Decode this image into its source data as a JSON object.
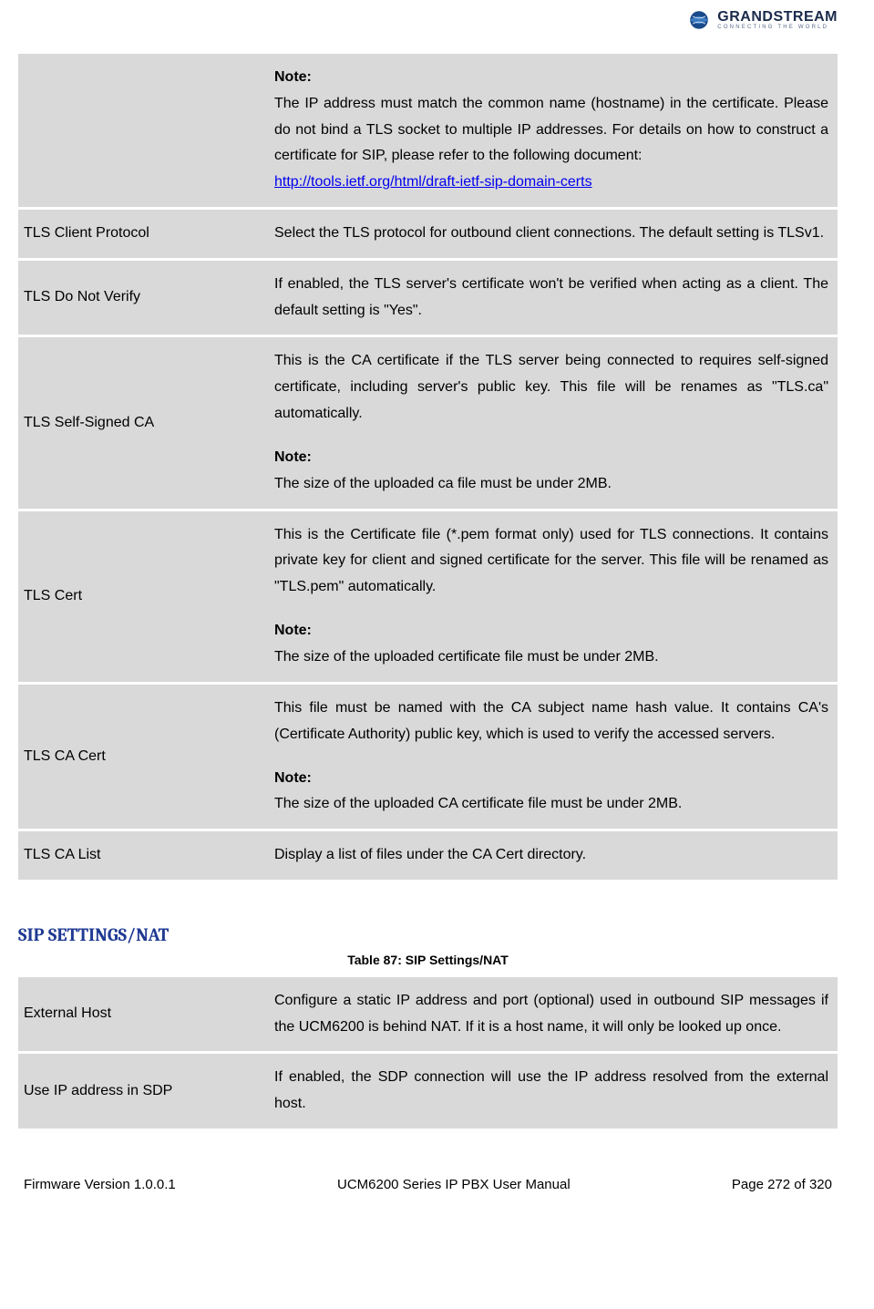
{
  "brand": {
    "name": "GRANDSTREAM",
    "tagline": "CONNECTING THE WORLD"
  },
  "table1": {
    "rows": [
      {
        "label": "",
        "note_label": "Note:",
        "desc": "The IP address must match the common name (hostname) in the certificate. Please do not bind a TLS socket to multiple IP addresses. For details on how to construct a certificate for SIP, please refer to the following document:",
        "link": "http://tools.ietf.org/html/draft-ietf-sip-domain-certs"
      },
      {
        "label": "TLS Client Protocol",
        "desc": "Select the TLS protocol for outbound client connections. The default setting is TLSv1."
      },
      {
        "label": "TLS Do Not Verify",
        "desc": "If enabled, the TLS server's certificate won't be verified when acting as a client. The default setting is \"Yes\"."
      },
      {
        "label": "TLS Self-Signed CA",
        "desc": "This is the CA certificate if the TLS server being connected to requires self-signed certificate, including server's public key. This file will be renames as \"TLS.ca\" automatically.",
        "note_label": "Note:",
        "note": "The size of the uploaded ca file must be under 2MB."
      },
      {
        "label": "TLS Cert",
        "desc": "This is the Certificate file (*.pem format only) used for TLS connections. It contains private key for client and signed certificate for the server. This file will be renamed as \"TLS.pem\" automatically.",
        "note_label": "Note:",
        "note": "The size of the uploaded certificate file must be under 2MB."
      },
      {
        "label": "TLS CA Cert",
        "desc": "This file must be named with the CA subject name hash value. It contains CA's (Certificate Authority) public key, which is used to verify the accessed servers.",
        "note_label": "Note:",
        "note": "The size of the uploaded CA certificate file must be under 2MB."
      },
      {
        "label": "TLS CA List",
        "desc": "Display a list of files under the CA Cert directory."
      }
    ]
  },
  "section2": {
    "heading": "SIP SETTINGS/NAT",
    "caption": "Table 87: SIP Settings/NAT",
    "rows": [
      {
        "label": "External Host",
        "desc": "Configure a static IP address and port (optional) used in outbound SIP messages if the UCM6200 is behind NAT. If it is a host name, it will only be looked up once."
      },
      {
        "label": "Use IP address in SDP",
        "desc": "If enabled, the SDP connection will use the IP address resolved from the external host."
      }
    ]
  },
  "footer": {
    "left": "Firmware Version 1.0.0.1",
    "center": "UCM6200 Series IP PBX User Manual",
    "right": "Page 272 of 320"
  }
}
